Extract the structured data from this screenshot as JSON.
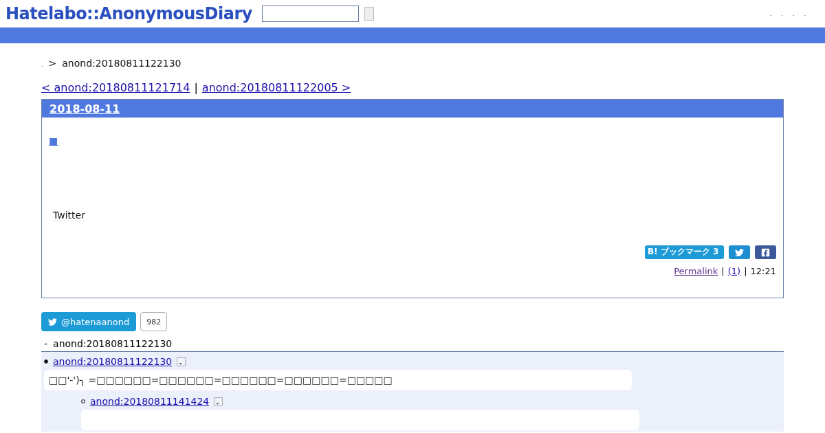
{
  "header": {
    "logo": "Hatelabo::AnonymousDiary",
    "nav": [
      ".",
      ".",
      ".",
      "."
    ]
  },
  "breadcrumb": {
    "home": ".",
    "separator": ">",
    "current": "anond:20180811122130"
  },
  "pager": {
    "prev": "< anond:20180811121714",
    "separator": "|",
    "next": "anond:20180811122005 >"
  },
  "entry": {
    "date": "2018-08-11",
    "title_mark": "■",
    "twitter": "Twitter",
    "bookmark": "B! ブックマーク 3",
    "permalink": "Permalink",
    "separator_1": "|",
    "comments": "(1)",
    "separator_2": "|",
    "time": "12:21"
  },
  "follow": {
    "label": "@hatenaanond",
    "count": "982"
  },
  "tree": {
    "dash": "-",
    "title": "anond:20180811122130",
    "items": [
      {
        "link": "anond:20180811122130",
        "body": "□□'-')╮ =□□□□□□=□□□□□□=□□□□□□=□□□□□□=□□□□□",
        "children": [
          {
            "link": "anond:20180811141424"
          }
        ]
      }
    ]
  }
}
